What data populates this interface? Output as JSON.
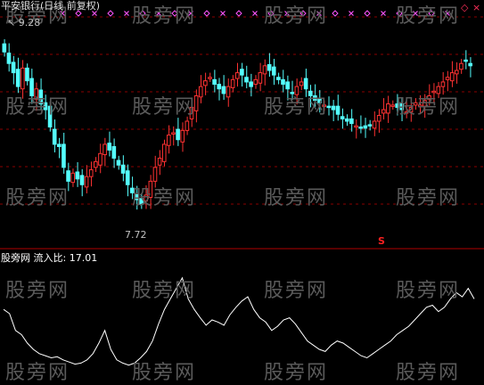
{
  "main_panel": {
    "title": "平安银行(日线 前复权)",
    "high_label": "9.28",
    "low_label": "7.72",
    "signal_text": "S",
    "watermark": "股旁网"
  },
  "indicator_panel": {
    "name": "股旁网",
    "indicator_label": "流入比:",
    "indicator_value": "17.01"
  },
  "window_controls": {
    "diamond_glyph": "◇",
    "close_glyph": "×"
  },
  "colors": {
    "up": "#ff3232",
    "down": "#54ffff",
    "grid": "#8a0000",
    "marker": "#ff54ff",
    "indicator_line": "#ffffff",
    "text": "#c0c0c0"
  },
  "chart_data": {
    "type": "candlestick",
    "price_range_visible": [
      7.72,
      9.28
    ],
    "closes": [
      9.1,
      9.0,
      8.92,
      8.8,
      8.96,
      8.85,
      8.72,
      8.78,
      8.65,
      8.6,
      8.45,
      8.3,
      8.28,
      8.1,
      7.98,
      8.05,
      8.0,
      7.95,
      8.02,
      8.08,
      8.15,
      8.22,
      8.3,
      8.25,
      8.18,
      8.12,
      8.05,
      7.95,
      7.88,
      7.82,
      7.78,
      7.86,
      7.98,
      8.1,
      8.18,
      8.3,
      8.38,
      8.4,
      8.34,
      8.42,
      8.5,
      8.62,
      8.72,
      8.8,
      8.85,
      8.88,
      8.82,
      8.78,
      8.74,
      8.8,
      8.86,
      8.92,
      8.9,
      8.84,
      8.8,
      8.86,
      8.92,
      8.98,
      8.94,
      8.9,
      8.86,
      8.82,
      8.78,
      8.74,
      8.8,
      8.84,
      8.78,
      8.72,
      8.68,
      8.66,
      8.64,
      8.62,
      8.6,
      8.56,
      8.52,
      8.5,
      8.48,
      8.46,
      8.45,
      8.44,
      8.46,
      8.5,
      8.55,
      8.6,
      8.65,
      8.64,
      8.62,
      8.6,
      8.58,
      8.62,
      8.66,
      8.64,
      8.68,
      8.72,
      8.76,
      8.8,
      8.84,
      8.88,
      8.92,
      8.94,
      9.0,
      9.02,
      8.98
    ],
    "indicator_values": [
      60,
      56,
      40,
      36,
      28,
      22,
      18,
      16,
      14,
      15,
      12,
      10,
      8,
      9,
      12,
      18,
      28,
      40,
      22,
      12,
      9,
      7,
      9,
      14,
      20,
      30,
      46,
      60,
      70,
      80,
      90,
      70,
      60,
      52,
      45,
      50,
      48,
      45,
      55,
      62,
      68,
      72,
      60,
      52,
      48,
      40,
      44,
      50,
      52,
      46,
      38,
      30,
      26,
      22,
      20,
      26,
      30,
      28,
      24,
      20,
      16,
      14,
      18,
      22,
      26,
      30,
      36,
      40,
      44,
      50,
      56,
      62,
      64,
      58,
      62,
      70,
      76,
      72,
      80,
      70
    ]
  }
}
